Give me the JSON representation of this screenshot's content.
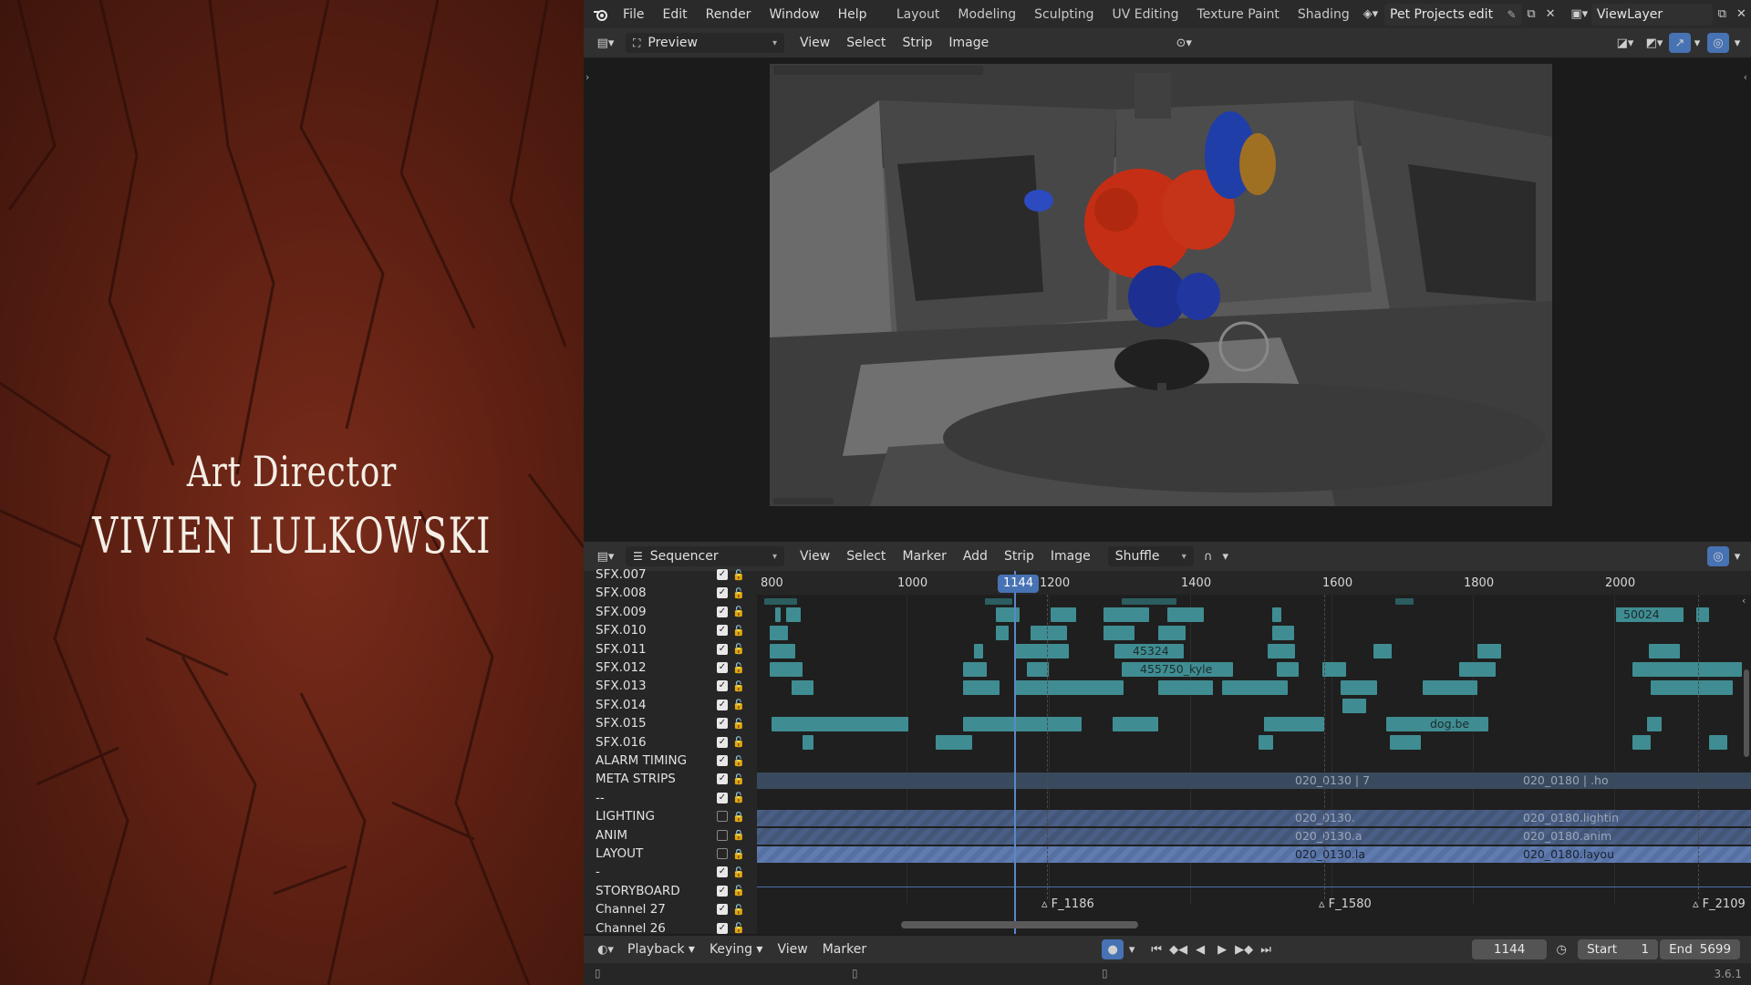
{
  "credit": {
    "role": "Art Director",
    "name": "VIVIEN LULKOWSKI"
  },
  "menubar": {
    "menus": [
      "File",
      "Edit",
      "Render",
      "Window",
      "Help"
    ],
    "workspaces": [
      "Layout",
      "Modeling",
      "Sculpting",
      "UV Editing",
      "Texture Paint",
      "Shading"
    ],
    "scene_name": "Pet Projects edit",
    "view_layer": "ViewLayer"
  },
  "preview_header": {
    "mode": "Preview",
    "menus": [
      "View",
      "Select",
      "Strip",
      "Image"
    ]
  },
  "sequencer_header": {
    "mode": "Sequencer",
    "menus": [
      "View",
      "Select",
      "Marker",
      "Add",
      "Strip",
      "Image"
    ],
    "overlap_mode": "Shuffle"
  },
  "channels": [
    {
      "name": "SFX.007",
      "visible": true,
      "locked": false
    },
    {
      "name": "SFX.008",
      "visible": true,
      "locked": false
    },
    {
      "name": "SFX.009",
      "visible": true,
      "locked": false
    },
    {
      "name": "SFX.010",
      "visible": true,
      "locked": false
    },
    {
      "name": "SFX.011",
      "visible": true,
      "locked": false
    },
    {
      "name": "SFX.012",
      "visible": true,
      "locked": false
    },
    {
      "name": "SFX.013",
      "visible": true,
      "locked": false
    },
    {
      "name": "SFX.014",
      "visible": true,
      "locked": false
    },
    {
      "name": "SFX.015",
      "visible": true,
      "locked": false
    },
    {
      "name": "SFX.016",
      "visible": true,
      "locked": false
    },
    {
      "name": "ALARM TIMING",
      "visible": true,
      "locked": false
    },
    {
      "name": "META STRIPS",
      "visible": true,
      "locked": false
    },
    {
      "name": "--",
      "visible": true,
      "locked": false
    },
    {
      "name": "LIGHTING",
      "visible": false,
      "locked": true
    },
    {
      "name": "ANIM",
      "visible": false,
      "locked": true
    },
    {
      "name": "LAYOUT",
      "visible": false,
      "locked": true
    },
    {
      "name": "-",
      "visible": true,
      "locked": false
    },
    {
      "name": "STORYBOARD",
      "visible": true,
      "locked": false
    },
    {
      "name": "Channel 27",
      "visible": true,
      "locked": false
    },
    {
      "name": "Channel 26",
      "visible": true,
      "locked": false
    }
  ],
  "ruler": {
    "ticks": [
      "800",
      "1000",
      "1200",
      "1400",
      "1600",
      "1800",
      "2000"
    ],
    "current_frame": "1144"
  },
  "strip_labels": {
    "sfx009": "50024",
    "sfx011": "45324",
    "sfx012": "455750_kyle",
    "sfx015": "dog.be",
    "meta_a": "020_0130 | 7",
    "meta_b": "020_0180 | .ho",
    "light_a": "020_0130.",
    "light_b": "020_0180.lightin",
    "anim_a": "020_0130.a",
    "anim_b": "020_0180.anim",
    "layout_a": "020_0130.la",
    "layout_b": "020_0180.layou"
  },
  "markers": [
    "F_1186",
    "F_1580",
    "F_2109"
  ],
  "playbar": {
    "menus": [
      "Playback",
      "Keying",
      "View",
      "Marker"
    ],
    "current_frame": "1144",
    "start_label": "Start",
    "start_value": "1",
    "end_label": "End",
    "end_value": "5699"
  },
  "status": {
    "version": "3.6.1"
  },
  "icons": [
    "blender-logo-icon",
    "editor-type-icon",
    "preview-icon",
    "sequencer-icon",
    "pin-icon",
    "new-scene-icon",
    "close-icon",
    "view-layer-icon",
    "play-icon",
    "record-icon",
    "timer-icon",
    "snap-icon",
    "overlay-icon",
    "gizmo-icon"
  ]
}
